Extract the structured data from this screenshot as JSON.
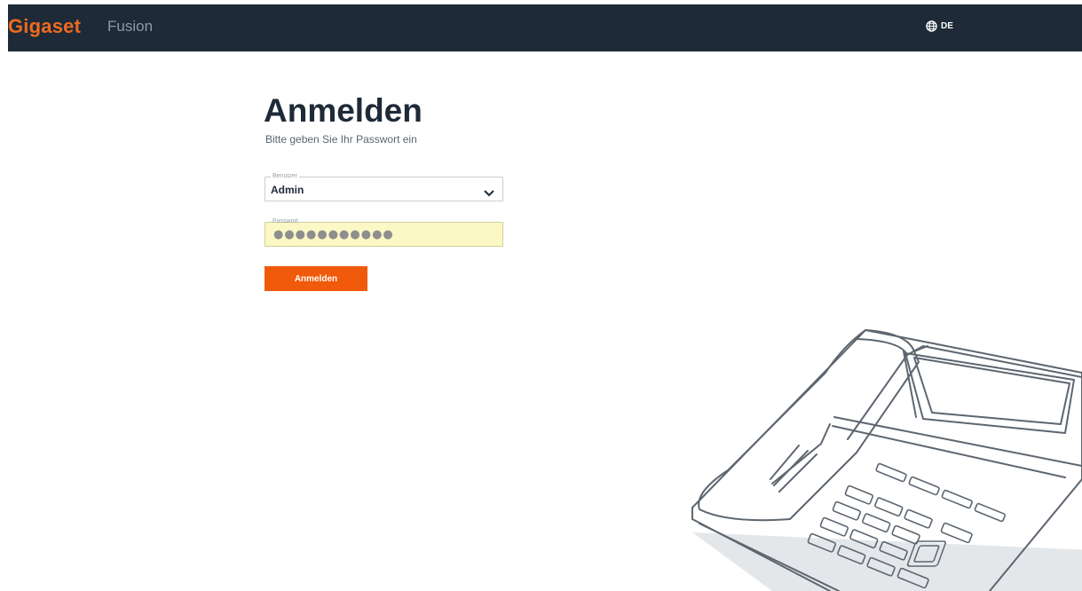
{
  "colors": {
    "header_bg": "#1e2a38",
    "brand_orange": "#ef6a1f",
    "header_text": "#ffffff",
    "product_text": "#8e98a4",
    "title_text": "#1e2a38",
    "subtitle_text": "#5a6470",
    "label_text": "#9aa1a9",
    "password_bg": "#fbf8c6",
    "password_border": "#cfcf9a",
    "password_dots": "#8e8e8e",
    "button_bg": "#f05a0a",
    "button_text": "#ffffff",
    "phone_stroke": "#5d6670",
    "phone_shadow": "#e4e7ea"
  },
  "header": {
    "brand": "Gigaset",
    "product": "Fusion",
    "language_icon": "globe-icon",
    "language": "DE"
  },
  "login": {
    "title": "Anmelden",
    "subtitle": "Bitte geben Sie Ihr Passwort ein",
    "user_label": "Benutzer",
    "user_value": "Admin",
    "user_dropdown_icon": "chevron-down-icon",
    "password_label": "Passwort",
    "password_value": "●●●●●●●●●●●",
    "submit_label": "Anmelden"
  }
}
